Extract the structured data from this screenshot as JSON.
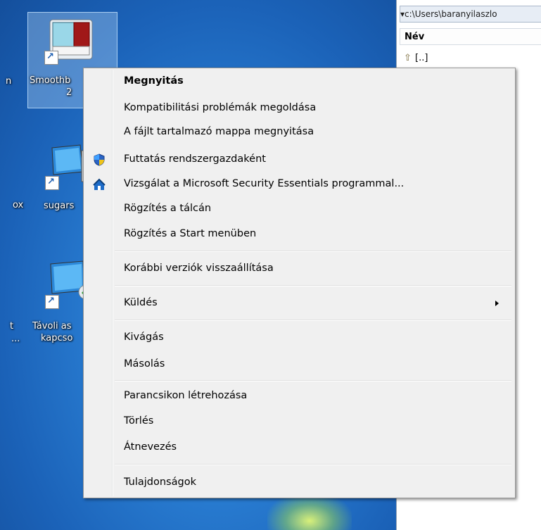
{
  "desktop": {
    "icons": [
      {
        "label_line1": "Smoothb",
        "label_line2": "2",
        "icon": "smoothboard-app-icon"
      },
      {
        "label_line1": "sugars",
        "icon": "computer-icon"
      },
      {
        "label_line1": "Távoli as",
        "label_line2": "kapcso",
        "icon": "remote-desktop-icon"
      }
    ],
    "partial_labels": [
      "n",
      "ox",
      "t",
      "..."
    ]
  },
  "explorer": {
    "path": "▾c:\\Users\\baranyilaszlo",
    "column_header": "Név",
    "rows": [
      {
        "icon": "folder-up-icon",
        "label": "[..]"
      }
    ]
  },
  "context_menu": {
    "items": [
      {
        "label": "Megnyitás",
        "bold": true
      },
      {
        "label": "Kompatibilitási problémák megoldása"
      },
      {
        "label": "A fájlt tartalmazó mappa megnyitása"
      },
      {
        "label": "Futtatás rendszergazdaként",
        "icon": "uac-shield-icon"
      },
      {
        "label": "Vizsgálat a Microsoft Security Essentials programmal...",
        "icon": "security-essentials-icon"
      },
      {
        "label": "Rögzítés a tálcán"
      },
      {
        "label": "Rögzítés a Start menüben"
      },
      {
        "label": "Korábbi verziók visszaállítása"
      },
      {
        "label": "Küldés",
        "submenu": true
      },
      {
        "label": "Kivágás"
      },
      {
        "label": "Másolás"
      },
      {
        "label": "Parancsikon létrehozása"
      },
      {
        "label": "Törlés"
      },
      {
        "label": "Átnevezés"
      },
      {
        "label": "Tulajdonságok"
      }
    ]
  }
}
